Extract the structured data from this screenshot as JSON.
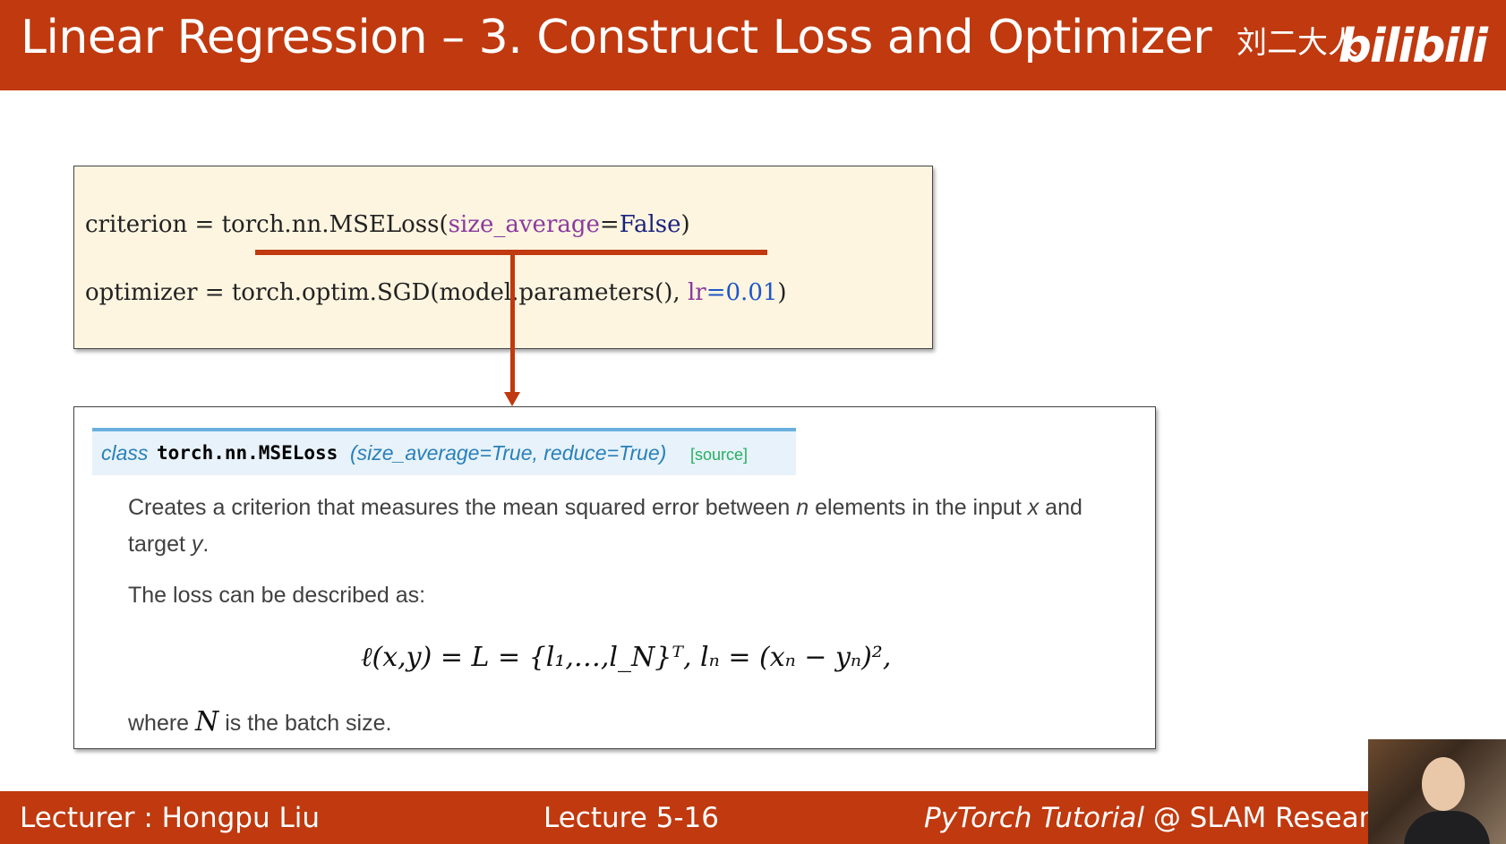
{
  "header": {
    "title": "Linear Regression – 3. Construct Loss and Optimizer",
    "brand_cn": "刘二大人",
    "brand_logo": "bilibili"
  },
  "code": {
    "line1": {
      "prefix": "criterion = torch.nn.MSELoss(",
      "kwarg": "size_average",
      "eq": "=",
      "value": "False",
      "suffix": ")"
    },
    "line2": {
      "prefix": "optimizer = torch.optim.SGD(model.parameters(), ",
      "kwarg": "lr",
      "eq": "=",
      "value": "0.01",
      "suffix": ")"
    }
  },
  "doc": {
    "class_kw": "class",
    "class_name": "torch.nn.MSELoss",
    "params": "(size_average=True, reduce=True)",
    "source": "[source]",
    "desc1_a": "Creates a criterion that measures the mean squared error between ",
    "desc1_n": "n",
    "desc1_b": " elements in the input ",
    "desc1_x": "x",
    "desc1_c": " and target ",
    "desc1_y": "y",
    "desc1_d": ".",
    "desc2": "The loss can be described as:",
    "formula": "ℓ(x,y) = L = {l₁,…,l_N}ᵀ,    lₙ = (xₙ − yₙ)²,",
    "desc3_a": "where ",
    "desc3_N": "N",
    "desc3_b": " is the batch size."
  },
  "footer": {
    "lecturer": "Lecturer : Hongpu Liu",
    "lecture": "Lecture 5-16",
    "course_italic": "PyTorch Tutorial",
    "course_rest": " @ SLAM Resear"
  },
  "colors": {
    "accent": "#c0390f",
    "code_bg": "#fdf5e0",
    "sig_bg": "#e7f2fa",
    "sig_border": "#6ab0de",
    "link_blue": "#2980b9",
    "source_green": "#27ae60"
  }
}
